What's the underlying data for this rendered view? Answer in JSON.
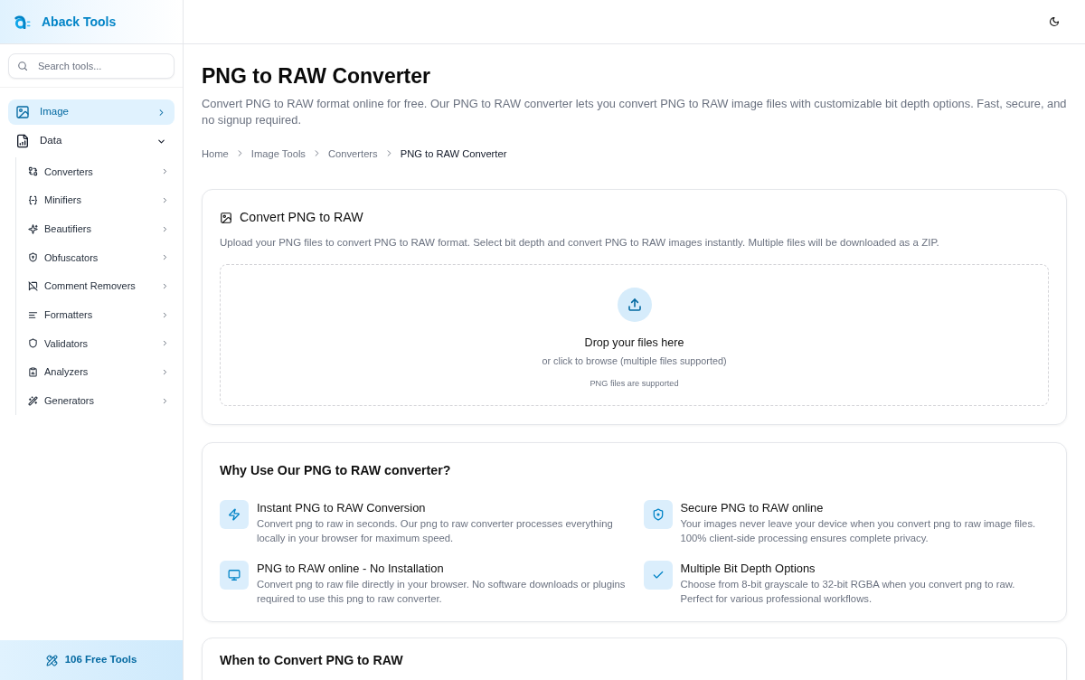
{
  "brand": {
    "name": "Aback Tools"
  },
  "search": {
    "placeholder": "Search tools..."
  },
  "nav": [
    {
      "label": "Image",
      "selected": true,
      "expanded": false
    },
    {
      "label": "Data",
      "selected": false,
      "expanded": true,
      "children": [
        {
          "label": "Converters",
          "expanded": false
        },
        {
          "label": "Minifiers",
          "expanded": false
        },
        {
          "label": "Beautifiers",
          "expanded": false
        },
        {
          "label": "Obfuscators",
          "expanded": false
        },
        {
          "label": "Comment Removers",
          "expanded": false
        },
        {
          "label": "Formatters",
          "expanded": false
        },
        {
          "label": "Validators",
          "expanded": false
        },
        {
          "label": "Analyzers",
          "expanded": false
        },
        {
          "label": "Generators",
          "expanded": false
        }
      ]
    }
  ],
  "sidebar_footer": {
    "label": "106 Free Tools"
  },
  "page": {
    "title": "PNG to RAW Converter",
    "description": "Convert PNG to RAW format online for free. Our PNG to RAW converter lets you convert PNG to RAW image files with customizable bit depth options. Fast, secure, and no signup required.",
    "breadcrumb": [
      {
        "label": "Home",
        "current": false
      },
      {
        "label": "Image Tools",
        "current": false
      },
      {
        "label": "Converters",
        "current": false
      },
      {
        "label": "PNG to RAW Converter",
        "current": true
      }
    ]
  },
  "converter_card": {
    "title": "Convert PNG to RAW",
    "description": "Upload your PNG files to convert PNG to RAW format. Select bit depth and convert PNG to RAW images instantly. Multiple files will be downloaded as a ZIP.",
    "dropzone": {
      "title": "Drop your files here",
      "subtitle": "or click to browse (multiple files supported)",
      "hint": "PNG files are supported"
    }
  },
  "features_card": {
    "title": "Why Use Our PNG to RAW converter?",
    "features": [
      {
        "title": "Instant PNG to RAW Conversion",
        "description": "Convert png to raw in seconds. Our png to raw converter processes everything locally in your browser for maximum speed."
      },
      {
        "title": "Secure PNG to RAW online",
        "description": "Your images never leave your device when you convert png to raw image files. 100% client-side processing ensures complete privacy."
      },
      {
        "title": "PNG to RAW online - No Installation",
        "description": "Convert png to raw file directly in your browser. No software downloads or plugins required to use this png to raw converter."
      },
      {
        "title": "Multiple Bit Depth Options",
        "description": "Choose from 8-bit grayscale to 32-bit RGBA when you convert png to raw. Perfect for various professional workflows."
      }
    ]
  },
  "next_card": {
    "title": "When to Convert PNG to RAW"
  }
}
